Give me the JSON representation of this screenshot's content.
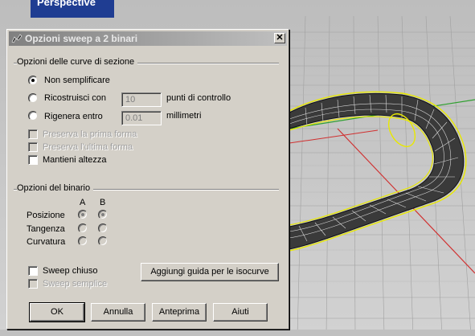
{
  "viewport": {
    "label": "Perspective",
    "colors": {
      "background": "#c6c6c6",
      "grid": "#9a9a9a",
      "axis_x": "#d03030",
      "axis_y": "#30a030",
      "highlight": "#e8e800"
    }
  },
  "dialog": {
    "title": "Opzioni sweep a 2 binari",
    "close_glyph": "✕",
    "section_curves": {
      "title": "Opzioni delle curve di sezione",
      "no_simplify_label": "Non semplificare",
      "rebuild_label": "Ricostruisci con",
      "rebuild_value": "10",
      "rebuild_unit": "punti di controllo",
      "refit_label": "Rigenera entro",
      "refit_value": "0.01",
      "refit_unit": "millimetri",
      "preserve_first_label": "Preserva la prima forma",
      "preserve_last_label": "Preserva l'ultima forma",
      "maintain_height_label": "Mantieni altezza"
    },
    "section_rail": {
      "title": "Opzioni del binario",
      "col_a": "A",
      "col_b": "B",
      "row_position": "Posizione",
      "row_tangency": "Tangenza",
      "row_curvature": "Curvatura"
    },
    "closed_sweep_label": "Sweep chiuso",
    "simple_sweep_label": "Sweep semplice",
    "add_guide_button": "Aggiungi guida per le isocurve",
    "buttons": {
      "ok": "OK",
      "cancel": "Annulla",
      "preview": "Anteprima",
      "help": "Aiuti"
    }
  }
}
